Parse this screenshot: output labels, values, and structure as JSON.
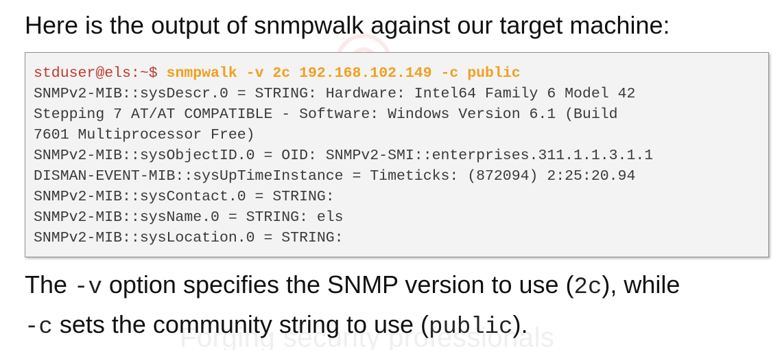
{
  "slide": {
    "heading": "Here is the output of snmpwalk against our target machine:",
    "terminal": {
      "prompt": "stduser@els:~$ ",
      "command": "snmpwalk -v 2c 192.168.102.149 -c public",
      "output_lines": [
        "SNMPv2-MIB::sysDescr.0 = STRING: Hardware: Intel64 Family 6 Model 42",
        "Stepping 7 AT/AT COMPATIBLE - Software: Windows Version 6.1 (Build",
        "7601 Multiprocessor Free)",
        "SNMPv2-MIB::sysObjectID.0 = OID: SNMPv2-SMI::enterprises.311.1.1.3.1.1",
        "DISMAN-EVENT-MIB::sysUpTimeInstance = Timeticks: (872094) 2:25:20.94",
        "SNMPv2-MIB::sysContact.0 = STRING:",
        "SNMPv2-MIB::sysName.0 = STRING: els",
        "SNMPv2-MIB::sysLocation.0 = STRING:"
      ]
    },
    "explanation": {
      "line1_text_a": "The ",
      "line1_code_a": "-v",
      "line1_text_b": " option specifies the SNMP version to use (",
      "line1_code_b": "2c",
      "line1_text_c": "), while",
      "line2_code_a": "-c",
      "line2_text_a": " sets the community string to use (",
      "line2_code_b": "public",
      "line2_text_b": ")."
    },
    "watermark": {
      "text": "Forging security professionals"
    }
  }
}
